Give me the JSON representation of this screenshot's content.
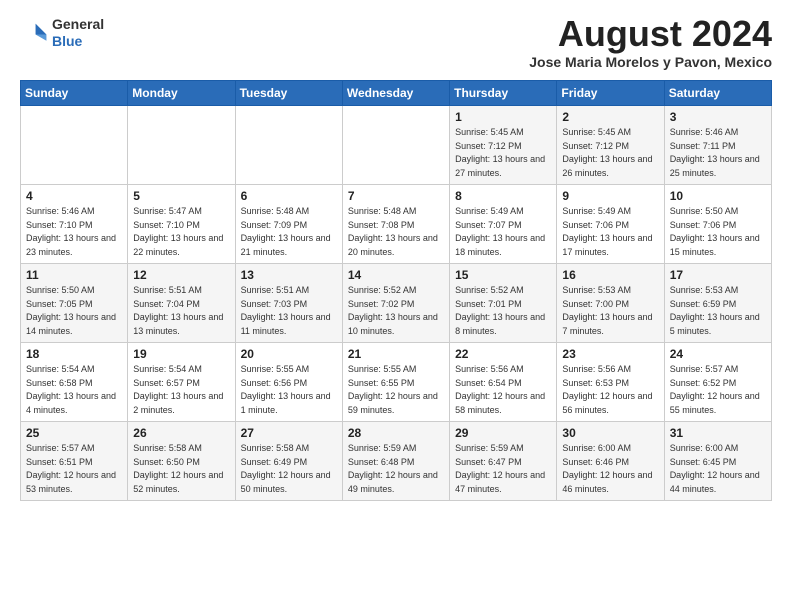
{
  "logo": {
    "general": "General",
    "blue": "Blue"
  },
  "title": {
    "month_year": "August 2024",
    "location": "Jose Maria Morelos y Pavon, Mexico"
  },
  "days_of_week": [
    "Sunday",
    "Monday",
    "Tuesday",
    "Wednesday",
    "Thursday",
    "Friday",
    "Saturday"
  ],
  "weeks": [
    [
      {
        "day": "",
        "info": ""
      },
      {
        "day": "",
        "info": ""
      },
      {
        "day": "",
        "info": ""
      },
      {
        "day": "",
        "info": ""
      },
      {
        "day": "1",
        "info": "Sunrise: 5:45 AM\nSunset: 7:12 PM\nDaylight: 13 hours\nand 27 minutes."
      },
      {
        "day": "2",
        "info": "Sunrise: 5:45 AM\nSunset: 7:12 PM\nDaylight: 13 hours\nand 26 minutes."
      },
      {
        "day": "3",
        "info": "Sunrise: 5:46 AM\nSunset: 7:11 PM\nDaylight: 13 hours\nand 25 minutes."
      }
    ],
    [
      {
        "day": "4",
        "info": "Sunrise: 5:46 AM\nSunset: 7:10 PM\nDaylight: 13 hours\nand 23 minutes."
      },
      {
        "day": "5",
        "info": "Sunrise: 5:47 AM\nSunset: 7:10 PM\nDaylight: 13 hours\nand 22 minutes."
      },
      {
        "day": "6",
        "info": "Sunrise: 5:48 AM\nSunset: 7:09 PM\nDaylight: 13 hours\nand 21 minutes."
      },
      {
        "day": "7",
        "info": "Sunrise: 5:48 AM\nSunset: 7:08 PM\nDaylight: 13 hours\nand 20 minutes."
      },
      {
        "day": "8",
        "info": "Sunrise: 5:49 AM\nSunset: 7:07 PM\nDaylight: 13 hours\nand 18 minutes."
      },
      {
        "day": "9",
        "info": "Sunrise: 5:49 AM\nSunset: 7:06 PM\nDaylight: 13 hours\nand 17 minutes."
      },
      {
        "day": "10",
        "info": "Sunrise: 5:50 AM\nSunset: 7:06 PM\nDaylight: 13 hours\nand 15 minutes."
      }
    ],
    [
      {
        "day": "11",
        "info": "Sunrise: 5:50 AM\nSunset: 7:05 PM\nDaylight: 13 hours\nand 14 minutes."
      },
      {
        "day": "12",
        "info": "Sunrise: 5:51 AM\nSunset: 7:04 PM\nDaylight: 13 hours\nand 13 minutes."
      },
      {
        "day": "13",
        "info": "Sunrise: 5:51 AM\nSunset: 7:03 PM\nDaylight: 13 hours\nand 11 minutes."
      },
      {
        "day": "14",
        "info": "Sunrise: 5:52 AM\nSunset: 7:02 PM\nDaylight: 13 hours\nand 10 minutes."
      },
      {
        "day": "15",
        "info": "Sunrise: 5:52 AM\nSunset: 7:01 PM\nDaylight: 13 hours\nand 8 minutes."
      },
      {
        "day": "16",
        "info": "Sunrise: 5:53 AM\nSunset: 7:00 PM\nDaylight: 13 hours\nand 7 minutes."
      },
      {
        "day": "17",
        "info": "Sunrise: 5:53 AM\nSunset: 6:59 PM\nDaylight: 13 hours\nand 5 minutes."
      }
    ],
    [
      {
        "day": "18",
        "info": "Sunrise: 5:54 AM\nSunset: 6:58 PM\nDaylight: 13 hours\nand 4 minutes."
      },
      {
        "day": "19",
        "info": "Sunrise: 5:54 AM\nSunset: 6:57 PM\nDaylight: 13 hours\nand 2 minutes."
      },
      {
        "day": "20",
        "info": "Sunrise: 5:55 AM\nSunset: 6:56 PM\nDaylight: 13 hours\nand 1 minute."
      },
      {
        "day": "21",
        "info": "Sunrise: 5:55 AM\nSunset: 6:55 PM\nDaylight: 12 hours\nand 59 minutes."
      },
      {
        "day": "22",
        "info": "Sunrise: 5:56 AM\nSunset: 6:54 PM\nDaylight: 12 hours\nand 58 minutes."
      },
      {
        "day": "23",
        "info": "Sunrise: 5:56 AM\nSunset: 6:53 PM\nDaylight: 12 hours\nand 56 minutes."
      },
      {
        "day": "24",
        "info": "Sunrise: 5:57 AM\nSunset: 6:52 PM\nDaylight: 12 hours\nand 55 minutes."
      }
    ],
    [
      {
        "day": "25",
        "info": "Sunrise: 5:57 AM\nSunset: 6:51 PM\nDaylight: 12 hours\nand 53 minutes."
      },
      {
        "day": "26",
        "info": "Sunrise: 5:58 AM\nSunset: 6:50 PM\nDaylight: 12 hours\nand 52 minutes."
      },
      {
        "day": "27",
        "info": "Sunrise: 5:58 AM\nSunset: 6:49 PM\nDaylight: 12 hours\nand 50 minutes."
      },
      {
        "day": "28",
        "info": "Sunrise: 5:59 AM\nSunset: 6:48 PM\nDaylight: 12 hours\nand 49 minutes."
      },
      {
        "day": "29",
        "info": "Sunrise: 5:59 AM\nSunset: 6:47 PM\nDaylight: 12 hours\nand 47 minutes."
      },
      {
        "day": "30",
        "info": "Sunrise: 6:00 AM\nSunset: 6:46 PM\nDaylight: 12 hours\nand 46 minutes."
      },
      {
        "day": "31",
        "info": "Sunrise: 6:00 AM\nSunset: 6:45 PM\nDaylight: 12 hours\nand 44 minutes."
      }
    ]
  ]
}
